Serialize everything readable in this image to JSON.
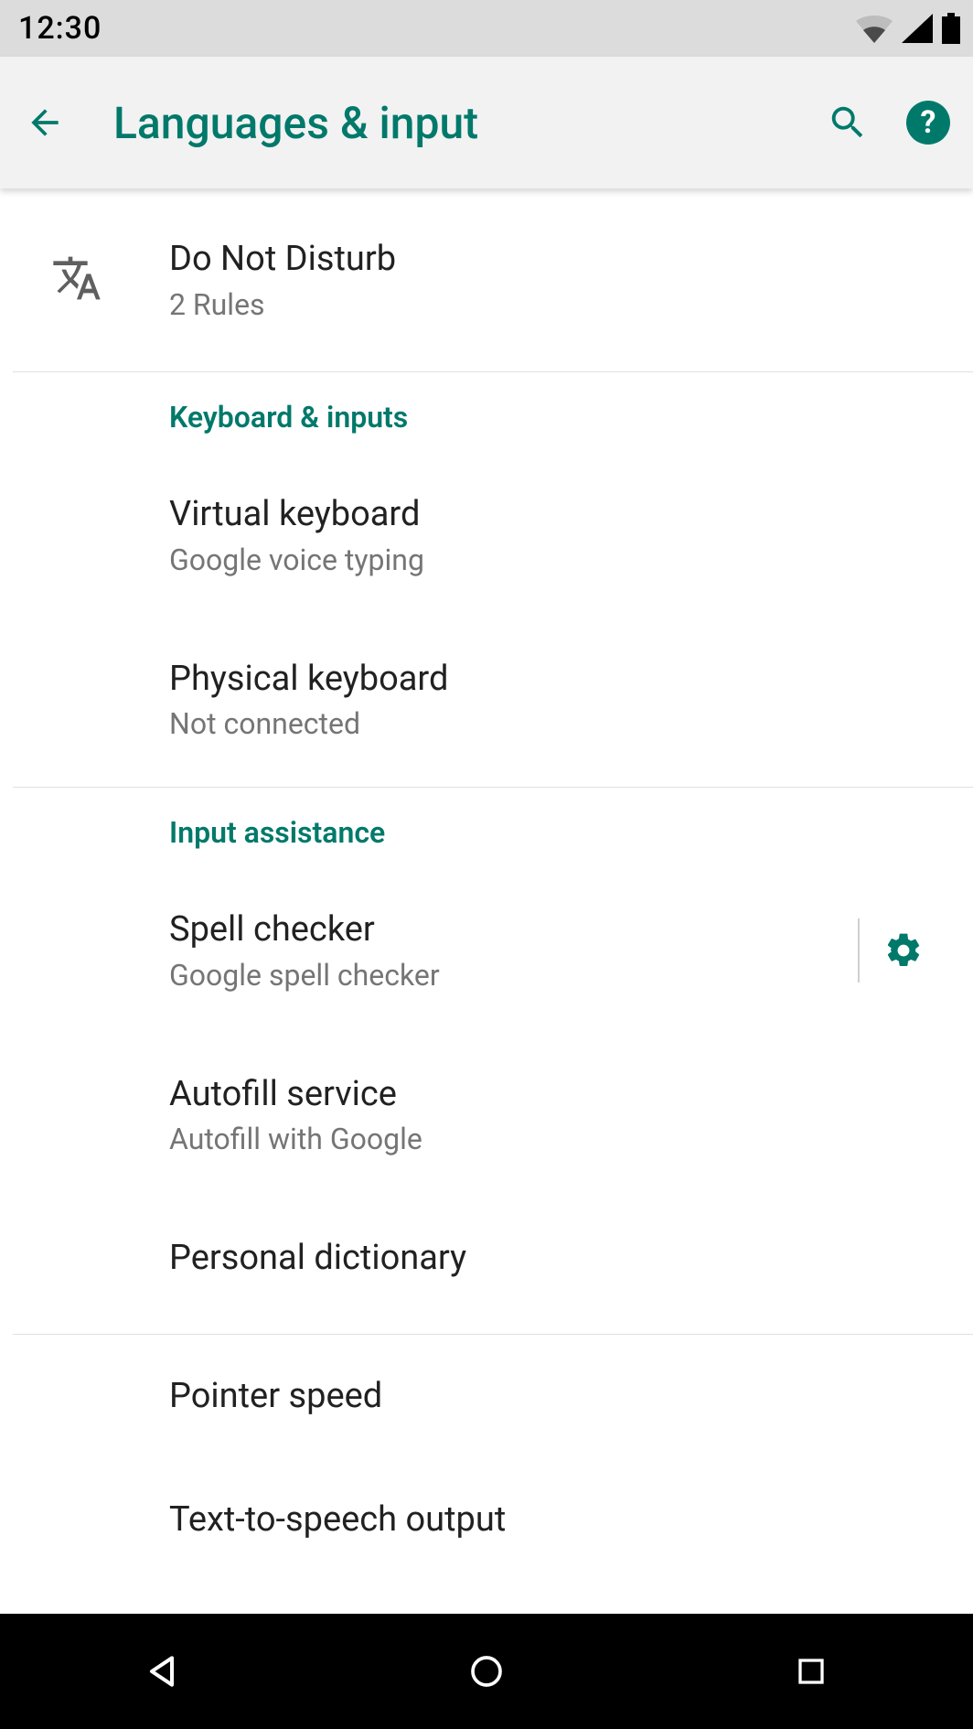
{
  "status": {
    "time": "12:30"
  },
  "appbar": {
    "title": "Languages & input"
  },
  "items": {
    "dnd": {
      "title": "Do Not Disturb",
      "sub": "2 Rules"
    },
    "vkb": {
      "title": "Virtual keyboard",
      "sub": "Google voice typing"
    },
    "pkb": {
      "title": "Physical keyboard",
      "sub": "Not connected"
    },
    "spell": {
      "title": "Spell checker",
      "sub": "Google spell checker"
    },
    "autofill": {
      "title": "Autofill service",
      "sub": "Autofill with Google"
    },
    "pdict": {
      "title": "Personal dictionary"
    },
    "pointer": {
      "title": "Pointer speed"
    },
    "tts": {
      "title": "Text-to-speech output"
    }
  },
  "sections": {
    "kb": "Keyboard & inputs",
    "ia": "Input assistance"
  },
  "colors": {
    "accent": "#00796b"
  }
}
